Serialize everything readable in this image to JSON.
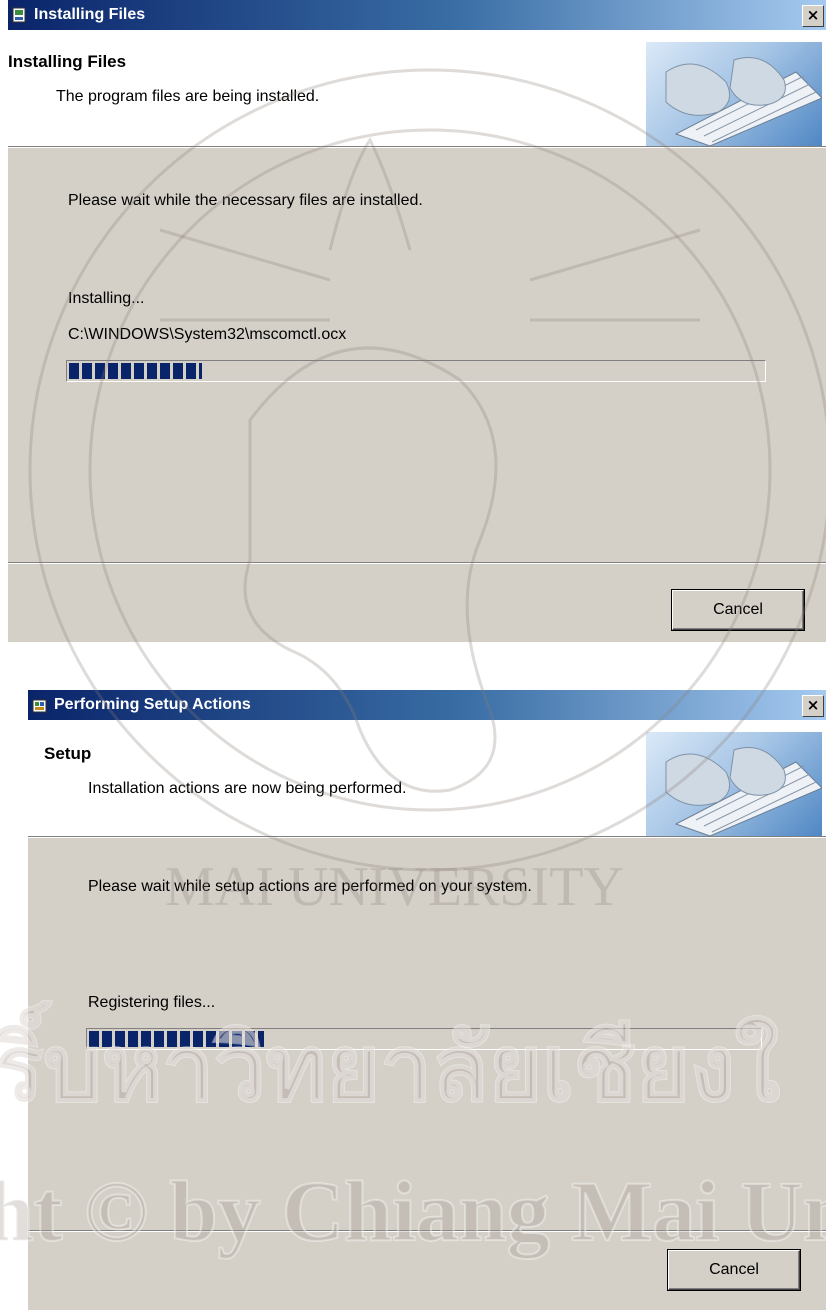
{
  "dialog1": {
    "window_title": "Installing Files",
    "header_title": "Installing Files",
    "header_subtitle": "The program files are being installed.",
    "message": "Please wait while the necessary files are installed.",
    "status_label": "Installing...",
    "current_file": "C:\\WINDOWS\\System32\\mscomctl.ocx",
    "progress_fraction": 0.19,
    "cancel_label": "Cancel",
    "close_glyph": "×"
  },
  "dialog2": {
    "window_title": "Performing Setup Actions",
    "header_title": "Setup",
    "header_subtitle": "Installation actions are now being performed.",
    "message": "Please wait while setup actions are performed on your system.",
    "status_label": "Registering files...",
    "progress_fraction": 0.26,
    "cancel_label": "Cancel",
    "close_glyph": "×"
  },
  "watermark": {
    "university_arc": "MAI UNIVERSITY",
    "thai_text": "ริ์บหาวิทยาลัยเชียงใ",
    "copyright_line": "ht © by Chiang Mai Unive"
  },
  "colors": {
    "titlebar_start": "#0a246a",
    "titlebar_end": "#a6caf0",
    "dialog_face": "#d4d0c8",
    "progress_block": "#0a246a"
  }
}
